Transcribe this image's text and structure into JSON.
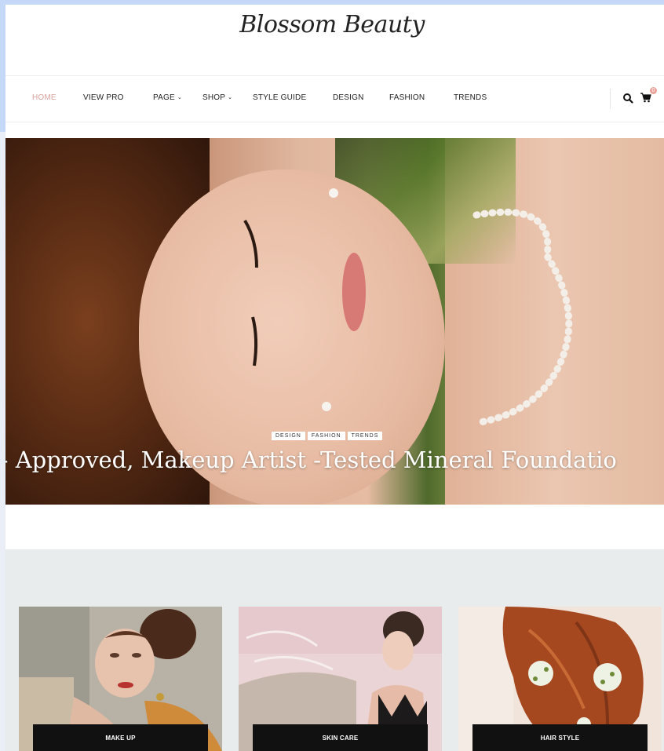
{
  "site": {
    "logo": "Blossom Beauty"
  },
  "nav": {
    "items": [
      {
        "label": "HOME",
        "active": true
      },
      {
        "label": "VIEW PRO"
      },
      {
        "label": "PAGE",
        "dropdown": true
      },
      {
        "label": "SHOP",
        "dropdown": true
      },
      {
        "label": "STYLE GUIDE"
      },
      {
        "label": "DESIGN"
      },
      {
        "label": "FASHION"
      },
      {
        "label": "TRENDS"
      }
    ],
    "cart_count": "0",
    "search_icon": "search-icon",
    "cart_icon": "cart-icon"
  },
  "hero": {
    "tags": [
      "DESIGN",
      "FASHION",
      "TRENDS"
    ],
    "title": "n- Approved, Makeup Artist -Tested Mineral Foundatio"
  },
  "categories": [
    {
      "label": "MAKE UP"
    },
    {
      "label": "SKIN CARE"
    },
    {
      "label": "HAIR STYLE"
    }
  ],
  "colors": {
    "accent": "#d9a39c",
    "nav_text": "#222222",
    "label_bg": "#111111",
    "section_bg": "#e9eced",
    "frame": "#c5d8f7"
  }
}
